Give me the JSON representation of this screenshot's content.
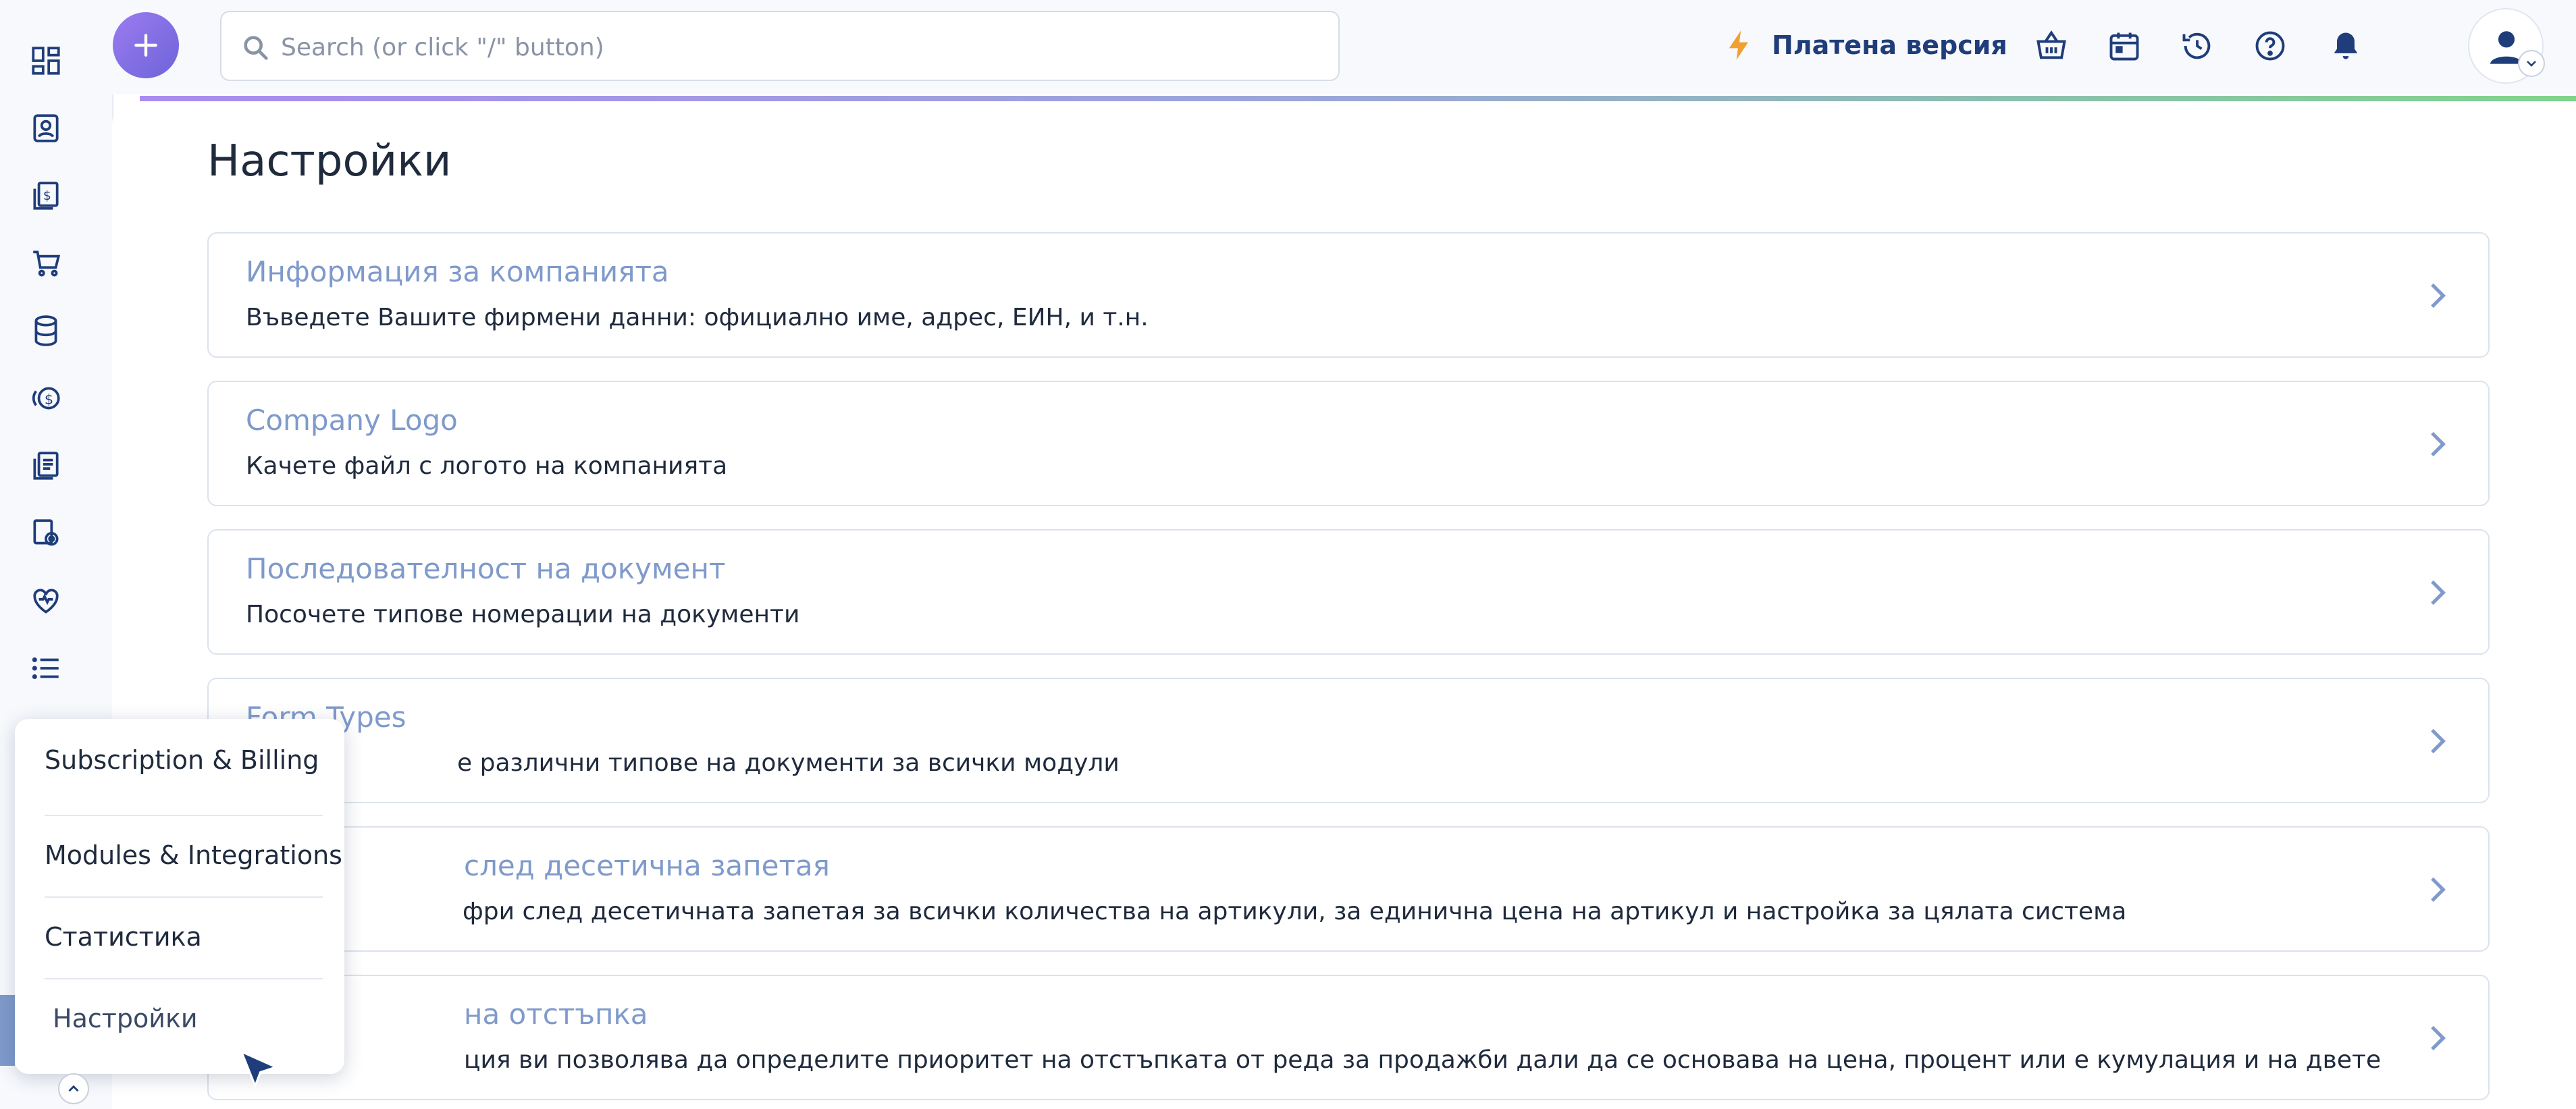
{
  "search": {
    "placeholder": "Search (or click \"/\" button)"
  },
  "header": {
    "paid_version_label": "Платена версия"
  },
  "page": {
    "title": "Настройки"
  },
  "cards": [
    {
      "title": "Информация за компанията",
      "description": "Въведете Вашите фирмени данни: официално име, адрес, ЕИН, и т.н."
    },
    {
      "title": "Company Logo",
      "description": "Качете файл с логото на компанията"
    },
    {
      "title": "Последователност на документ",
      "description": "Посочете типове номерации на документи"
    },
    {
      "title": "Form Types",
      "description": "е различни типове на документи за всички модули"
    },
    {
      "title": " след десетична запетая",
      "description": "фри след десетичната запетая за всички количества на артикули, за единична цена на артикул и настройка за цялата система"
    },
    {
      "title": "на отстъпка",
      "description": "ция ви позволява да определите приоритет на отстъпката от реда за продажби дали да се основава на цена, процент или е кумулация и на двете"
    }
  ],
  "popup_menu": {
    "items": [
      {
        "label": "Subscription & Billing"
      },
      {
        "label": "Modules & Integrations"
      },
      {
        "label": "Статистика"
      },
      {
        "label": "Настройки"
      }
    ]
  },
  "icons": {
    "rail": [
      "dashboard-icon",
      "contacts-icon",
      "invoices-icon",
      "cart-icon",
      "database-icon",
      "payments-icon",
      "documents-icon",
      "settings-docs-icon",
      "health-icon",
      "list-icon"
    ],
    "toolbar": [
      "bolt-icon",
      "basket-icon",
      "calendar-icon",
      "history-icon",
      "help-icon",
      "bell-icon"
    ]
  },
  "colors": {
    "accent": "#7f9acb",
    "primary_text": "#1f2a3d",
    "brand_blue": "#1f3d7a",
    "bolt": "#f0a030",
    "add_button": "#7a6be0"
  }
}
